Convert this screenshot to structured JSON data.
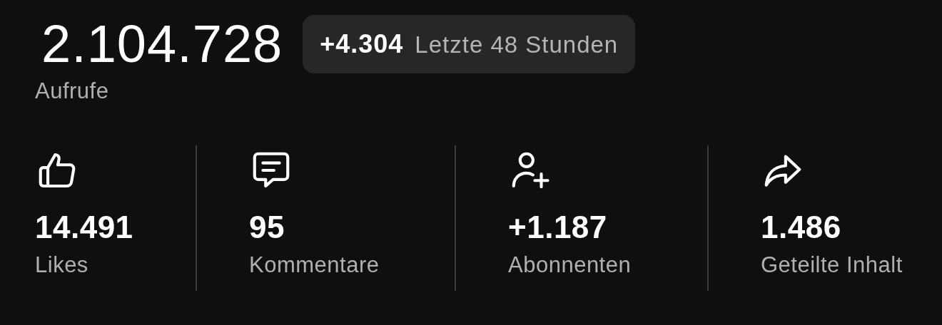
{
  "views": {
    "value": "2.104.728",
    "label": "Aufrufe"
  },
  "recent": {
    "delta": "+4.304",
    "period": "Letzte 48 Stunden"
  },
  "stats": [
    {
      "kind": "likes",
      "value": "14.491",
      "label": "Likes"
    },
    {
      "kind": "comments",
      "value": "95",
      "label": "Kommentare"
    },
    {
      "kind": "subscribers",
      "value": "+1.187",
      "label": "Abonnenten"
    },
    {
      "kind": "shares",
      "value": "1.486",
      "label": "Geteilte Inhalt"
    }
  ]
}
